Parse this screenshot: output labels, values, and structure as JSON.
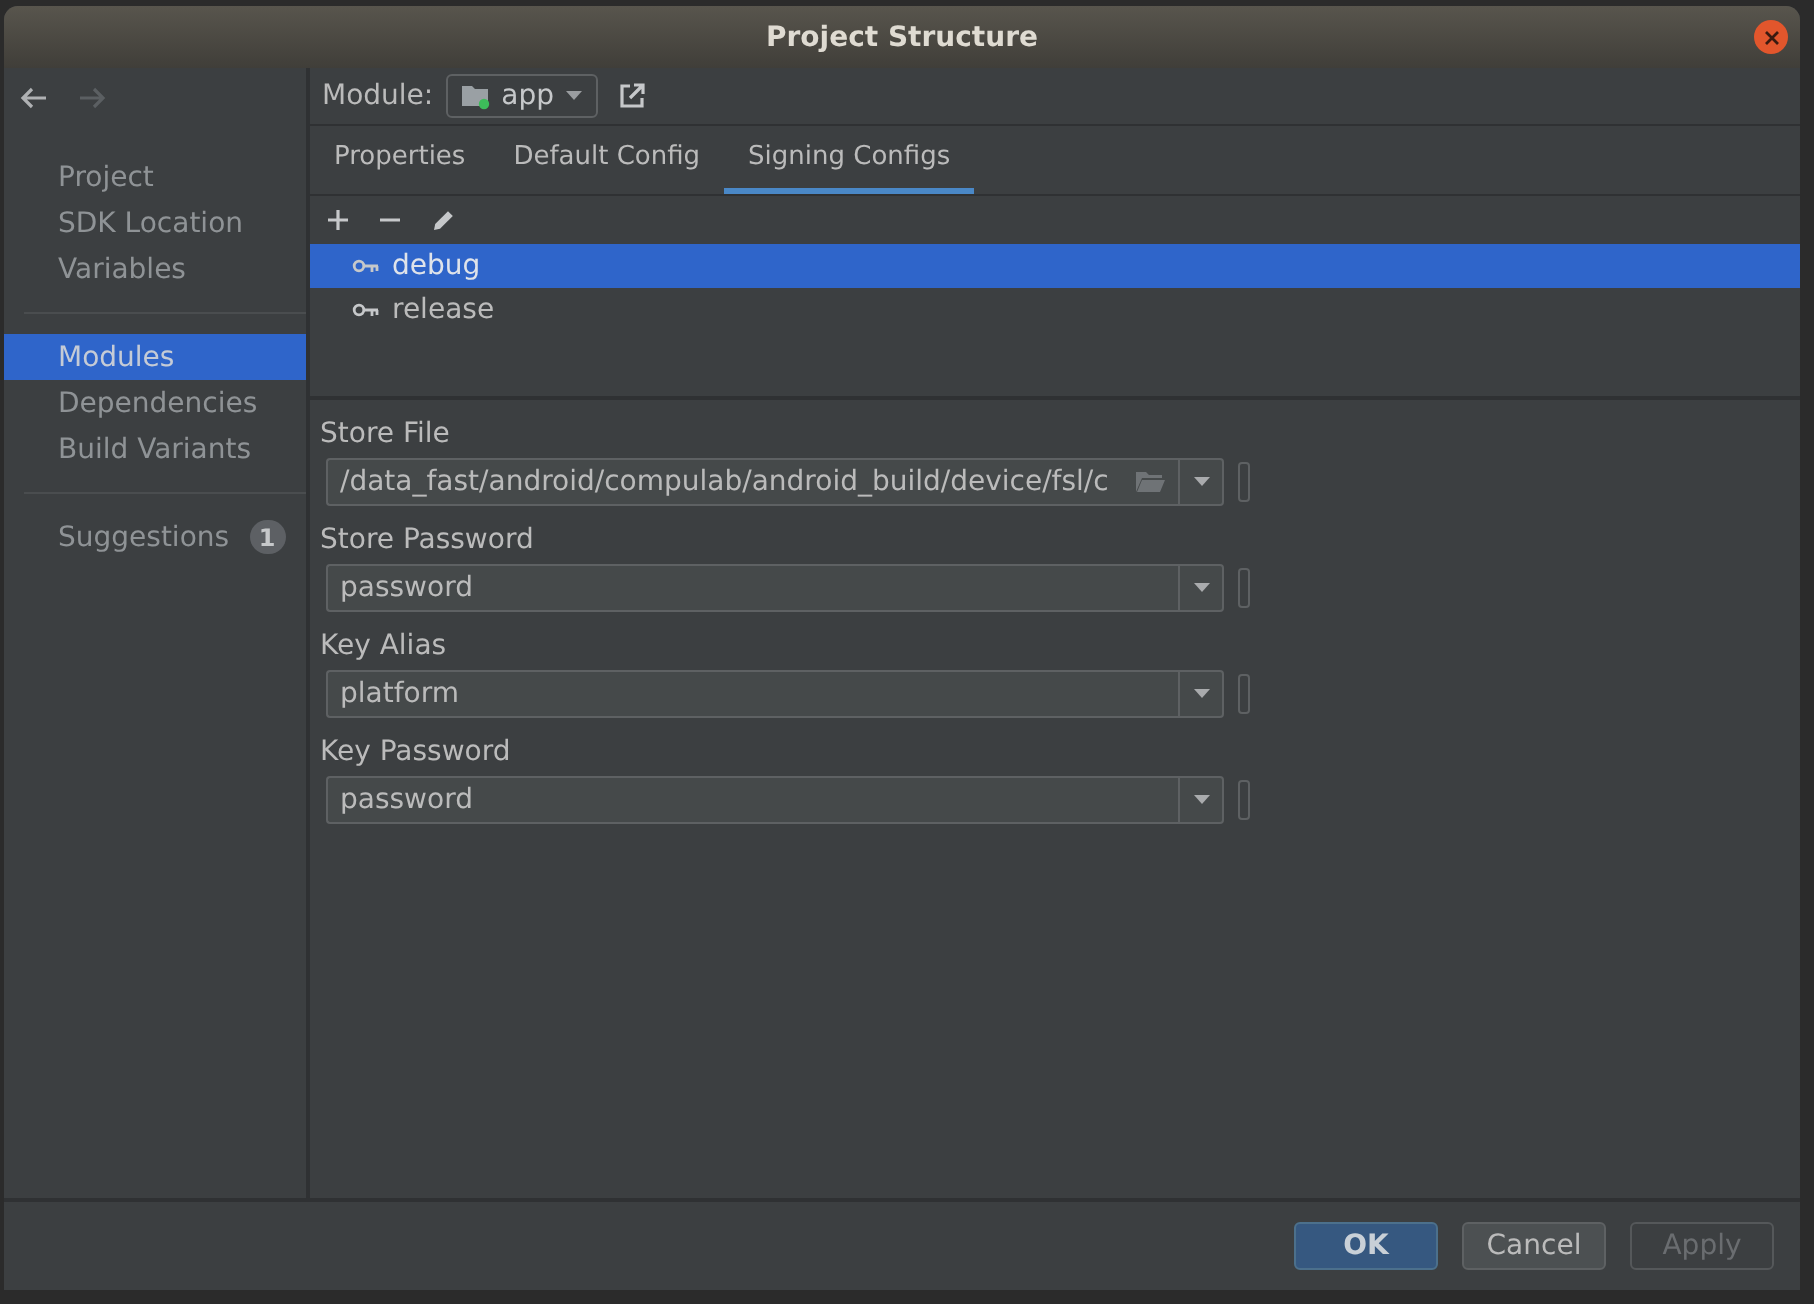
{
  "window": {
    "title": "Project Structure"
  },
  "navigation": {
    "back_disabled": false,
    "forward_disabled": true
  },
  "sidebar": {
    "groups": [
      {
        "items": [
          {
            "label": "Project",
            "selected": false
          },
          {
            "label": "SDK Location",
            "selected": false
          },
          {
            "label": "Variables",
            "selected": false
          }
        ]
      },
      {
        "items": [
          {
            "label": "Modules",
            "selected": true
          },
          {
            "label": "Dependencies",
            "selected": false
          },
          {
            "label": "Build Variants",
            "selected": false
          }
        ]
      },
      {
        "items": [
          {
            "label": "Suggestions",
            "selected": false,
            "badge": "1"
          }
        ]
      }
    ]
  },
  "module_selector": {
    "label": "Module:",
    "value": "app"
  },
  "tabs": [
    {
      "label": "Properties",
      "selected": false
    },
    {
      "label": "Default Config",
      "selected": false
    },
    {
      "label": "Signing Configs",
      "selected": true
    }
  ],
  "configs": [
    {
      "name": "debug",
      "selected": true
    },
    {
      "name": "release",
      "selected": false
    }
  ],
  "fields": [
    {
      "label": "Store File",
      "value": "/data_fast/android/compulab/android_build/device/fsl/c",
      "kind": "file"
    },
    {
      "label": "Store Password",
      "value": "password",
      "kind": "dropdown"
    },
    {
      "label": "Key Alias",
      "value": "platform",
      "kind": "dropdown"
    },
    {
      "label": "Key Password",
      "value": "password",
      "kind": "dropdown"
    }
  ],
  "buttons": [
    {
      "label": "OK",
      "kind": "default",
      "disabled": false
    },
    {
      "label": "Cancel",
      "kind": "normal",
      "disabled": false
    },
    {
      "label": "Apply",
      "kind": "normal",
      "disabled": true
    }
  ]
}
